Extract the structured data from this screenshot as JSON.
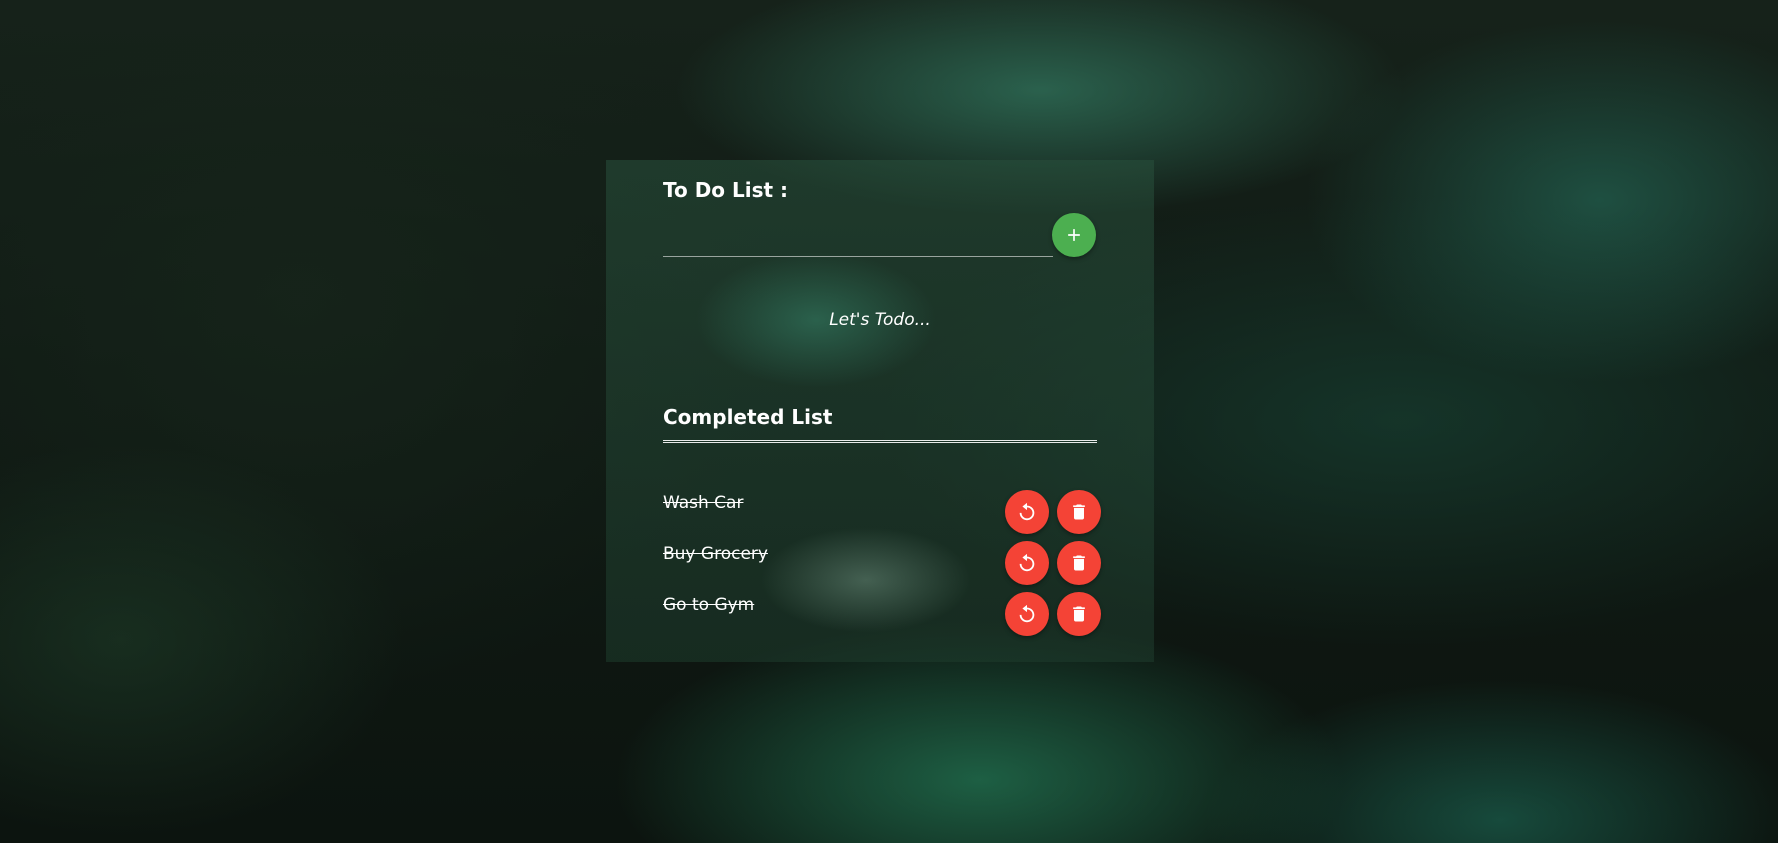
{
  "todo": {
    "title": "To Do List :",
    "input_value": "",
    "input_placeholder": "",
    "add_icon": "plus-icon",
    "add_color": "#4caf50",
    "empty_message": "Let's Todo..."
  },
  "completed": {
    "title": "Completed List",
    "action_color": "#f44336",
    "redo_icon": "undo-icon",
    "delete_icon": "trash-icon",
    "items": [
      {
        "label": "Wash Car"
      },
      {
        "label": "Buy Grocery"
      },
      {
        "label": "Go to Gym"
      }
    ]
  }
}
